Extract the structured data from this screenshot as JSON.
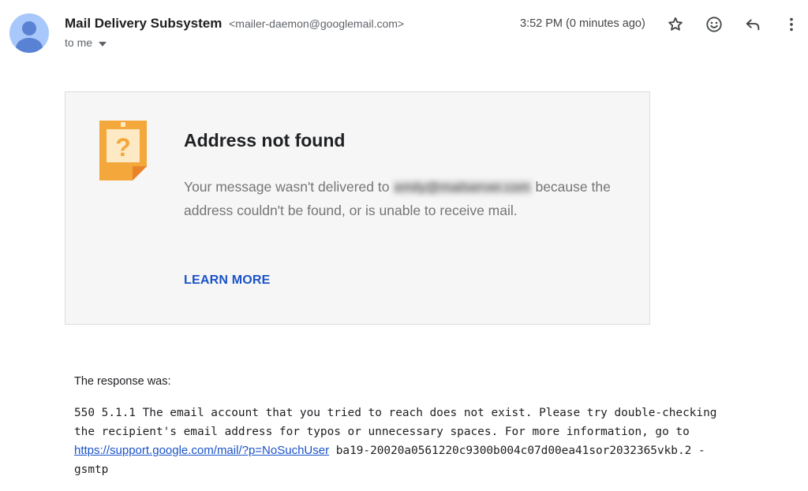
{
  "header": {
    "sender_name": "Mail Delivery Subsystem",
    "sender_email": "<mailer-daemon@googlemail.com>",
    "recipient_label": "to me",
    "timestamp": "3:52 PM (0 minutes ago)",
    "icons": [
      "avatar-person-icon",
      "star-icon",
      "emoji-icon",
      "reply-icon",
      "more-vertical-icon"
    ]
  },
  "card": {
    "title": "Address not found",
    "message_prefix": "Your message wasn't delivered to",
    "redacted_address": "emily@mailserver.com",
    "message_suffix": "because the address couldn't be found, or is unable to receive mail.",
    "learn_more": "LEARN MORE",
    "icon": "question-note-icon"
  },
  "response": {
    "label": "The response was:",
    "text_before_link": "550 5.1.1 The email account that you tried to reach does not exist. Please try double-checking\nthe recipient's email address for typos or unnecessary spaces. For more information, go to\n",
    "link": "https://support.google.com/mail/?p=NoSuchUser",
    "text_after_link": " ba19-20020a0561220c9300b004c07d00ea41sor2032365vkb.2 -\ngsmtp"
  },
  "colors": {
    "link": "#1a53c8",
    "note_orange": "#f4a73b",
    "note_light": "#fde9c4",
    "avatar": "#a8c7fa",
    "avatar_person": "#5a82d4"
  }
}
